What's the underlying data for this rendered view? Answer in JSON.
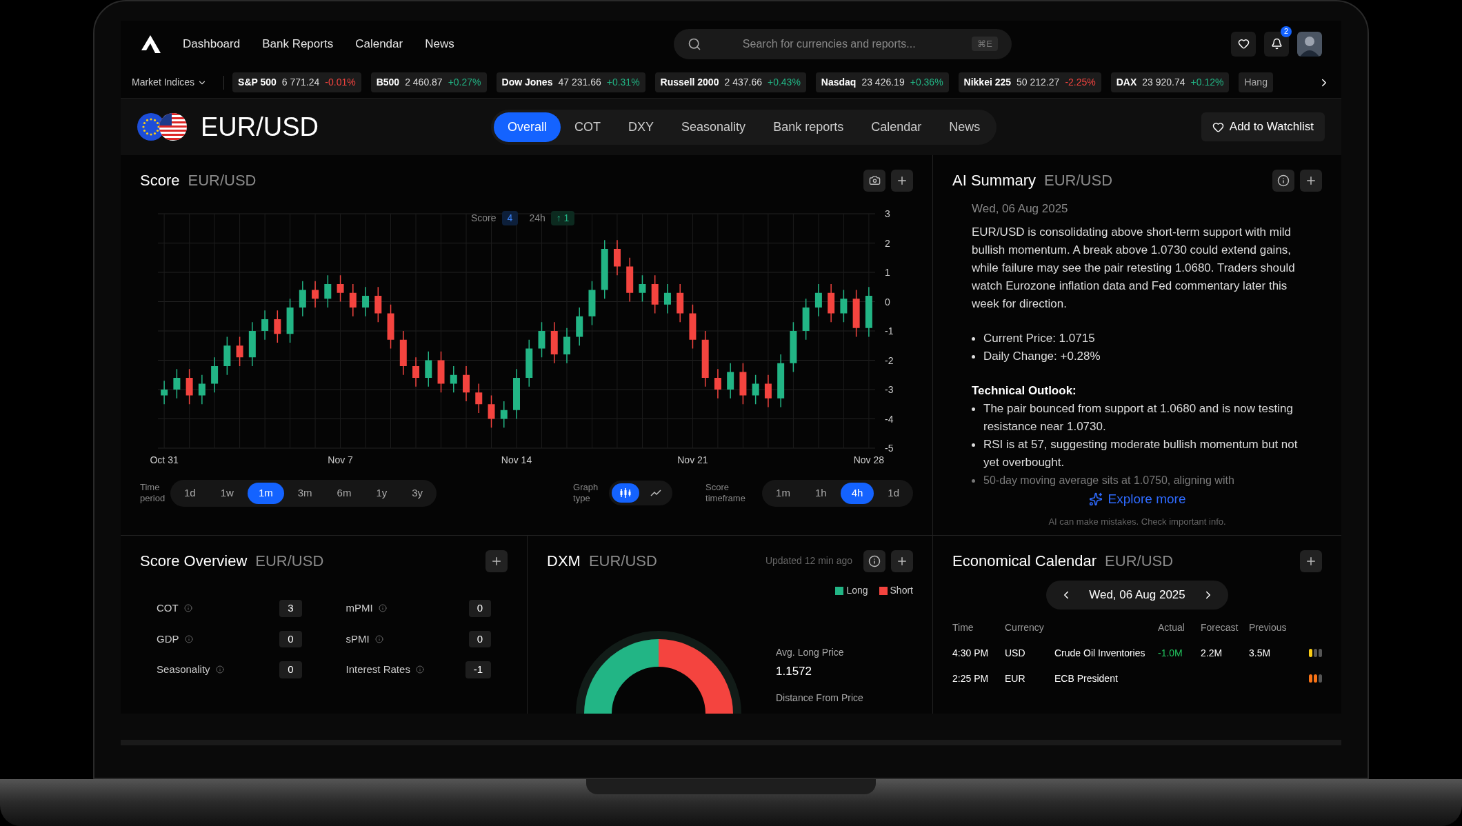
{
  "nav": {
    "links": [
      {
        "label": "Dashboard"
      },
      {
        "label": "Bank Reports"
      },
      {
        "label": "Calendar"
      },
      {
        "label": "News"
      }
    ],
    "search": {
      "placeholder": "Search for currencies and reports...",
      "shortcut": "⌘E"
    },
    "notifications": "2"
  },
  "ticker": {
    "label": "Market Indices",
    "items": [
      {
        "name": "S&P 500",
        "value": "6 771.24",
        "change": "-0.01%",
        "negative": true
      },
      {
        "name": "B500",
        "value": "2 460.87",
        "change": "+0.27%",
        "negative": false
      },
      {
        "name": "Dow Jones",
        "value": "47 231.66",
        "change": "+0.31%",
        "negative": false
      },
      {
        "name": "Russell 2000",
        "value": "2 437.66",
        "change": "+0.43%",
        "negative": false
      },
      {
        "name": "Nasdaq",
        "value": "23 426.19",
        "change": "+0.36%",
        "negative": false
      },
      {
        "name": "Nikkei 225",
        "value": "50 212.27",
        "change": "-2.25%",
        "negative": true
      },
      {
        "name": "DAX",
        "value": "23 920.74",
        "change": "+0.12%",
        "negative": false
      },
      {
        "name": "Hang"
      }
    ]
  },
  "pair": {
    "title": "EUR/USD",
    "tabs": [
      {
        "label": "Overall",
        "selected": true
      },
      {
        "label": "COT",
        "selected": false
      },
      {
        "label": "DXY",
        "selected": false
      },
      {
        "label": "Seasonality",
        "selected": false
      },
      {
        "label": "Bank reports",
        "selected": false
      },
      {
        "label": "Calendar",
        "selected": false
      },
      {
        "label": "News",
        "selected": false
      }
    ],
    "watchlist": "Add to Watchlist"
  },
  "score": {
    "title": "Score",
    "subtitle": "EUR/USD",
    "badge": {
      "score_label": "Score",
      "score": "4",
      "change_label": "24h",
      "change": "↑ 1"
    },
    "chart_data": {
      "type": "candlestick",
      "categories": [
        "Oct 31",
        null,
        null,
        null,
        null,
        null,
        null,
        null,
        null,
        null,
        null,
        null,
        null,
        null,
        "Nov 7",
        null,
        null,
        null,
        null,
        null,
        null,
        null,
        null,
        null,
        null,
        null,
        null,
        null,
        "Nov 14",
        null,
        null,
        null,
        null,
        null,
        null,
        null,
        null,
        null,
        null,
        null,
        null,
        null,
        "Nov 21",
        null,
        null,
        null,
        null,
        null,
        null,
        null,
        null,
        null,
        null,
        null,
        null,
        null,
        "Nov 28"
      ],
      "ohlc": [
        [
          -3.2,
          -2.7,
          -3.5,
          -3.0
        ],
        [
          -3.0,
          -2.3,
          -3.3,
          -2.6
        ],
        [
          -2.6,
          -2.3,
          -3.5,
          -3.2
        ],
        [
          -3.2,
          -2.5,
          -3.5,
          -2.8
        ],
        [
          -2.8,
          -1.9,
          -3.1,
          -2.2
        ],
        [
          -2.2,
          -1.2,
          -2.5,
          -1.5
        ],
        [
          -1.5,
          -1.2,
          -2.2,
          -1.9
        ],
        [
          -1.9,
          -0.7,
          -2.2,
          -1.0
        ],
        [
          -1.0,
          -0.3,
          -1.3,
          -0.6
        ],
        [
          -0.6,
          -0.3,
          -1.4,
          -1.1
        ],
        [
          -1.1,
          0.1,
          -1.4,
          -0.2
        ],
        [
          -0.2,
          0.7,
          -0.5,
          0.4
        ],
        [
          0.4,
          0.7,
          -0.2,
          0.1
        ],
        [
          0.1,
          0.9,
          -0.2,
          0.6
        ],
        [
          0.6,
          0.9,
          0.0,
          0.3
        ],
        [
          0.3,
          0.6,
          -0.5,
          -0.2
        ],
        [
          -0.2,
          0.5,
          -0.5,
          0.2
        ],
        [
          0.2,
          0.5,
          -0.7,
          -0.4
        ],
        [
          -0.4,
          -0.1,
          -1.6,
          -1.3
        ],
        [
          -1.3,
          -1.0,
          -2.5,
          -2.2
        ],
        [
          -2.2,
          -1.9,
          -2.9,
          -2.6
        ],
        [
          -2.6,
          -1.7,
          -2.9,
          -2.0
        ],
        [
          -2.0,
          -1.7,
          -3.1,
          -2.8
        ],
        [
          -2.8,
          -2.2,
          -3.1,
          -2.5
        ],
        [
          -2.5,
          -2.2,
          -3.4,
          -3.1
        ],
        [
          -3.1,
          -2.8,
          -3.8,
          -3.5
        ],
        [
          -3.5,
          -3.2,
          -4.3,
          -4.0
        ],
        [
          -4.0,
          -3.4,
          -4.3,
          -3.7
        ],
        [
          -3.7,
          -2.3,
          -4.0,
          -2.6
        ],
        [
          -2.6,
          -1.3,
          -2.9,
          -1.6
        ],
        [
          -1.6,
          -0.7,
          -1.9,
          -1.0
        ],
        [
          -1.0,
          -0.7,
          -2.1,
          -1.8
        ],
        [
          -1.8,
          -0.9,
          -2.1,
          -1.2
        ],
        [
          -1.2,
          -0.2,
          -1.5,
          -0.5
        ],
        [
          -0.5,
          0.7,
          -0.8,
          0.4
        ],
        [
          0.4,
          2.1,
          0.1,
          1.8
        ],
        [
          1.8,
          2.1,
          0.9,
          1.2
        ],
        [
          1.2,
          1.5,
          0.0,
          0.3
        ],
        [
          0.3,
          0.9,
          0.0,
          0.6
        ],
        [
          0.6,
          0.9,
          -0.4,
          -0.1
        ],
        [
          -0.1,
          0.6,
          -0.4,
          0.3
        ],
        [
          0.3,
          0.6,
          -0.7,
          -0.4
        ],
        [
          -0.4,
          -0.1,
          -1.6,
          -1.3
        ],
        [
          -1.3,
          -1.0,
          -2.9,
          -2.6
        ],
        [
          -2.6,
          -2.3,
          -3.3,
          -3.0
        ],
        [
          -3.0,
          -2.1,
          -3.3,
          -2.4
        ],
        [
          -2.4,
          -2.1,
          -3.5,
          -3.2
        ],
        [
          -3.2,
          -2.5,
          -3.5,
          -2.8
        ],
        [
          -2.8,
          -2.5,
          -3.6,
          -3.3
        ],
        [
          -3.3,
          -1.8,
          -3.6,
          -2.1
        ],
        [
          -2.1,
          -0.7,
          -2.4,
          -1.0
        ],
        [
          -1.0,
          0.1,
          -1.3,
          -0.2
        ],
        [
          -0.2,
          0.6,
          -0.5,
          0.3
        ],
        [
          0.3,
          0.6,
          -0.7,
          -0.4
        ],
        [
          -0.4,
          0.4,
          -0.7,
          0.1
        ],
        [
          0.1,
          0.4,
          -1.2,
          -0.9
        ],
        [
          -0.9,
          0.5,
          -1.2,
          0.2
        ]
      ],
      "ylim": [
        -5,
        3
      ],
      "grid": true,
      "yticks": [
        {
          "value": 3,
          "label": "3"
        },
        {
          "value": 2,
          "label": "2"
        },
        {
          "value": 1,
          "label": "1"
        },
        {
          "value": 0,
          "label": "0"
        },
        {
          "value": -1,
          "label": "-1"
        },
        {
          "value": -2,
          "label": "-2"
        },
        {
          "value": -3,
          "label": "-3"
        },
        {
          "value": -4,
          "label": "-4"
        },
        {
          "value": -5,
          "label": "-5"
        }
      ]
    },
    "time_period": {
      "label": "Time period",
      "options": [
        {
          "label": "1d",
          "selected": false
        },
        {
          "label": "1w",
          "selected": false
        },
        {
          "label": "1m",
          "selected": true
        },
        {
          "label": "3m",
          "selected": false
        },
        {
          "label": "6m",
          "selected": false
        },
        {
          "label": "1y",
          "selected": false
        },
        {
          "label": "3y",
          "selected": false
        }
      ]
    },
    "graph_type": {
      "label": "Graph type",
      "options": [
        {
          "kind": "candles",
          "selected": true
        },
        {
          "kind": "line",
          "selected": false
        }
      ]
    },
    "score_timeframe": {
      "label": "Score timeframe",
      "options": [
        {
          "label": "1m",
          "selected": false
        },
        {
          "label": "1h",
          "selected": false
        },
        {
          "label": "4h",
          "selected": true
        },
        {
          "label": "1d",
          "selected": false
        }
      ]
    }
  },
  "ai_summary": {
    "title": "AI Summary",
    "subtitle": "EUR/USD",
    "date": "Wed, 06 Aug 2025",
    "paragraph": "EUR/USD is consolidating above short-term support with mild bullish momentum. A break above 1.0730 could extend gains, while failure may see the pair retesting 1.0680. Traders should watch Eurozone inflation data and Fed commentary later this week for direction.",
    "bullets": [
      "Current Price: 1.0715",
      "Daily Change: +0.28%"
    ],
    "section_title": "Technical Outlook:",
    "outlook": [
      "The pair bounced from support at 1.0680 and is now testing resistance near 1.0730.",
      "RSI is at 57, suggesting moderate bullish momentum but not yet overbought."
    ],
    "faded": "50-day moving average sits at 1.0750, aligning with",
    "explore": "Explore more",
    "disclaimer": "AI can make mistakes. Check important info."
  },
  "score_overview": {
    "title": "Score Overview",
    "subtitle": "EUR/USD",
    "items": [
      {
        "label": "COT",
        "value": "3"
      },
      {
        "label": "mPMI",
        "value": "0"
      },
      {
        "label": "GDP",
        "value": "0"
      },
      {
        "label": "sPMI",
        "value": "0"
      },
      {
        "label": "Seasonality",
        "value": "0"
      },
      {
        "label": "Interest Rates",
        "value": "-1"
      }
    ]
  },
  "dxm": {
    "title": "DXM",
    "subtitle": "EUR/USD",
    "updated": "Updated 12 min ago",
    "legend": [
      {
        "label": "Long",
        "color": "#22b585"
      },
      {
        "label": "Short",
        "color": "#f4443f"
      }
    ],
    "avg_label": "Avg. Long Price",
    "avg_value": "1.1572",
    "distance_label": "Distance From Price"
  },
  "calendar": {
    "title": "Economical Calendar",
    "subtitle": "EUR/USD",
    "date": "Wed, 06 Aug 2025",
    "columns": [
      "Time",
      "Currency",
      "Actual",
      "Forecast",
      "Previous"
    ],
    "rows": [
      {
        "time": "4:30 PM",
        "currency": "USD",
        "event": "Crude Oil Inventories",
        "actual": "-1.0M",
        "positive": true,
        "forecast": "2.2M",
        "previous": "3.5M",
        "level": 0.34
      },
      {
        "time": "2:25 PM",
        "currency": "EUR",
        "event": "ECB President",
        "level": 0.67
      }
    ]
  }
}
